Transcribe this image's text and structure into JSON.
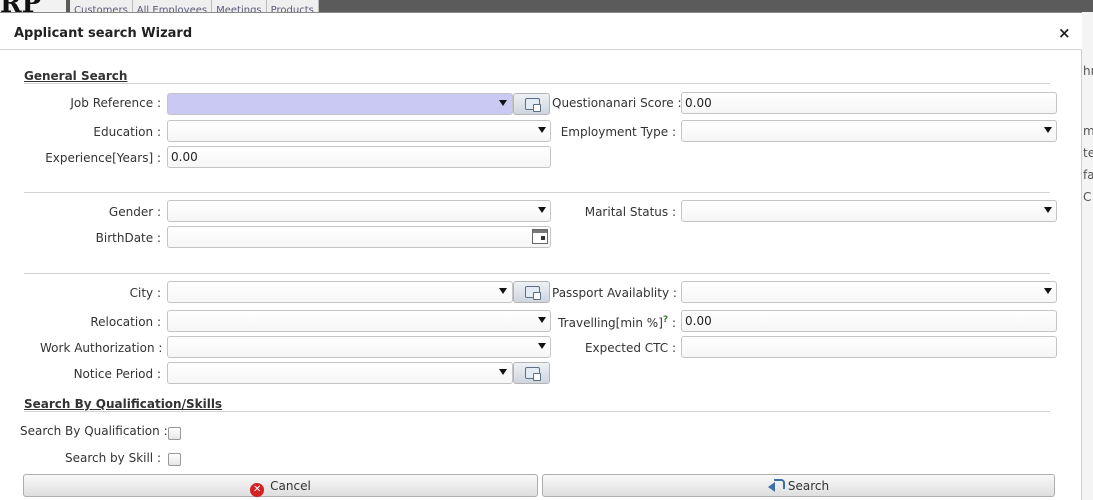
{
  "background": {
    "nav": [
      "Customers",
      "All Employees",
      "Meetings",
      "Products"
    ],
    "right_fragments": [
      "hr",
      "m",
      "te",
      "fa",
      "C"
    ]
  },
  "dialog": {
    "title": "Applicant search Wizard",
    "close_glyph": "×"
  },
  "sections": {
    "general": "General Search",
    "qualification": "Search By Qualification/Skills"
  },
  "fields": {
    "job_reference": {
      "label": "Job Reference :",
      "value": ""
    },
    "questionnaire_score": {
      "label": "Questionanari Score :",
      "value": "0.00"
    },
    "education": {
      "label": "Education :",
      "value": ""
    },
    "employment_type": {
      "label": "Employment Type :",
      "value": ""
    },
    "experience": {
      "label": "Experience[Years] :",
      "value": "0.00"
    },
    "gender": {
      "label": "Gender :",
      "value": ""
    },
    "marital_status": {
      "label": "Marital Status :",
      "value": ""
    },
    "birthdate": {
      "label": "BirthDate :",
      "value": ""
    },
    "city": {
      "label": "City :",
      "value": ""
    },
    "passport": {
      "label": "Passport Availablity :",
      "value": ""
    },
    "relocation": {
      "label": "Relocation :",
      "value": ""
    },
    "travelling": {
      "label": "Travelling[min %]",
      "help": "?",
      "colon": ":",
      "value": "0.00"
    },
    "work_authorization": {
      "label": "Work Authorization :",
      "value": ""
    },
    "expected_ctc": {
      "label": "Expected CTC :",
      "value": ""
    },
    "notice_period": {
      "label": "Notice Period :",
      "value": ""
    },
    "search_by_qualification": {
      "label": "Search By Qualification :",
      "checked": false
    },
    "search_by_skill": {
      "label": "Search by Skill :",
      "checked": false
    }
  },
  "buttons": {
    "cancel": "Cancel",
    "search": "Search"
  },
  "icons": {
    "cancel": "cancel-circle-icon",
    "search": "search-arrow-icon",
    "lookup": "lookup-icon",
    "calendar": "calendar-icon"
  }
}
